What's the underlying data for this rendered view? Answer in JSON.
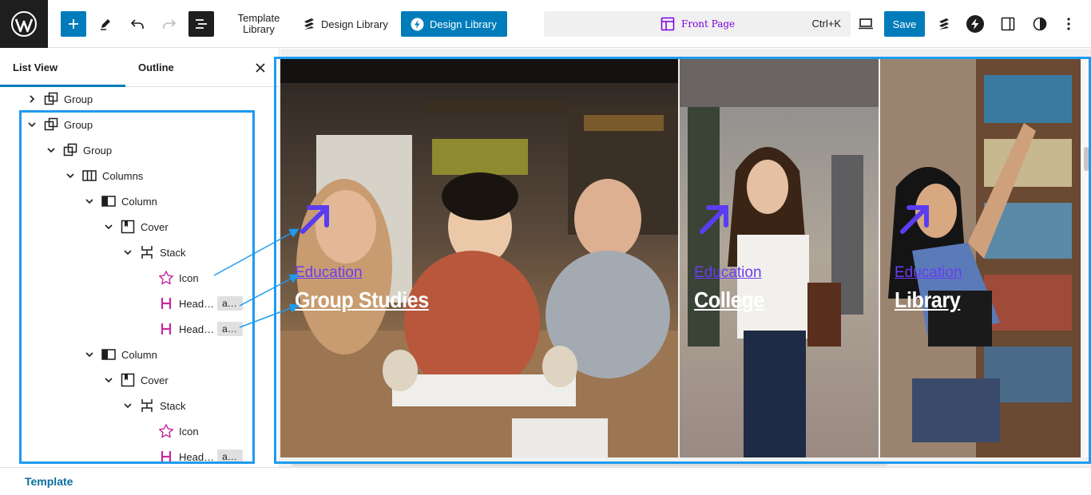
{
  "toolbar": {
    "template_library": "Template Library",
    "design_library_1": "Design Library",
    "design_library_2": "Design Library",
    "command_title": "Front Page",
    "command_shortcut": "Ctrl+K",
    "save_label": "Save"
  },
  "sidebar": {
    "tab_list_view": "List View",
    "tab_outline": "Outline",
    "tree": [
      {
        "label": "Group",
        "icon": "group-icon",
        "expanded": false
      },
      {
        "label": "Group",
        "icon": "group-icon",
        "expanded": true
      },
      {
        "label": "Group",
        "icon": "group-icon",
        "expanded": true
      },
      {
        "label": "Columns",
        "icon": "columns-icon",
        "expanded": true
      },
      {
        "label": "Column",
        "icon": "column-icon",
        "expanded": true
      },
      {
        "label": "Cover",
        "icon": "cover-icon",
        "expanded": true
      },
      {
        "label": "Stack",
        "icon": "stack-icon",
        "expanded": true
      },
      {
        "label": "Icon",
        "icon": "star-icon"
      },
      {
        "label": "Head…",
        "icon": "heading-icon",
        "badge": "a…"
      },
      {
        "label": "Head…",
        "icon": "heading-icon",
        "badge": "a…"
      },
      {
        "label": "Column",
        "icon": "column-icon",
        "expanded": true
      },
      {
        "label": "Cover",
        "icon": "cover-icon",
        "expanded": true
      },
      {
        "label": "Stack",
        "icon": "stack-icon",
        "expanded": true
      },
      {
        "label": "Icon",
        "icon": "star-icon"
      },
      {
        "label": "Head…",
        "icon": "heading-icon",
        "badge": "a…"
      }
    ]
  },
  "cards": [
    {
      "category": "Education",
      "title": "Group Studies"
    },
    {
      "category": "Education",
      "title": "College"
    },
    {
      "category": "Education",
      "title": "Library"
    }
  ],
  "footer": {
    "link": "Template"
  },
  "colors": {
    "accent": "#007cba",
    "highlight": "#1e9bf0",
    "dark": "#1e1e1e",
    "link_purple": "#6b3df0",
    "heading_pink": "#c52a9c"
  }
}
